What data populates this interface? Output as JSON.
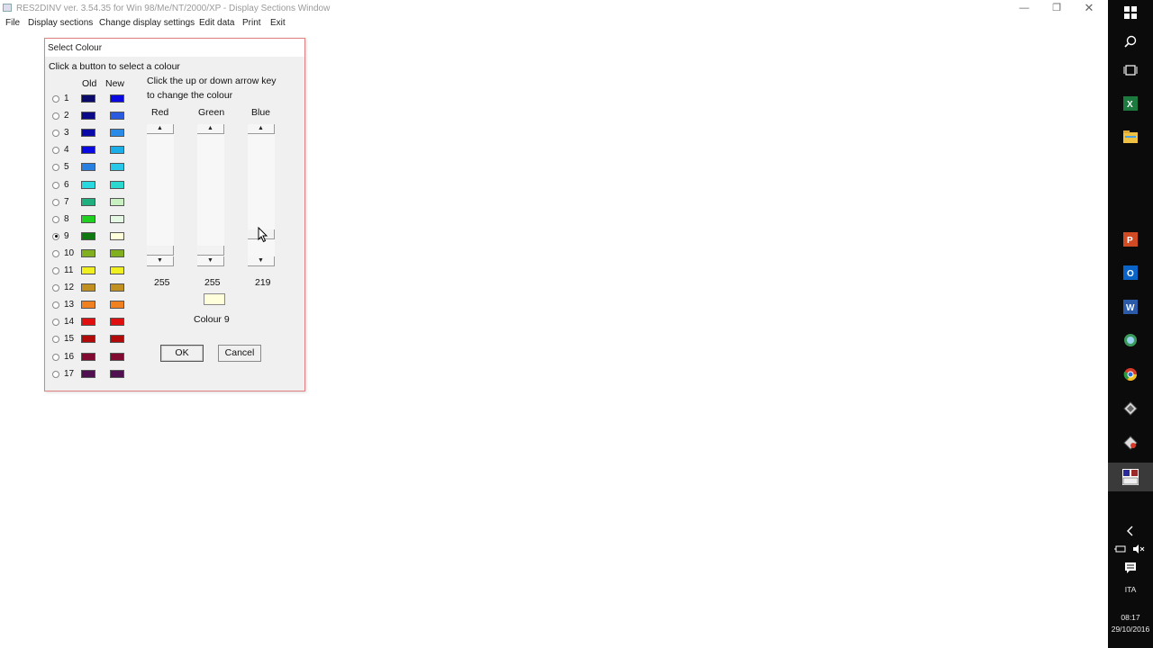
{
  "window": {
    "title": "RES2DINV ver. 3.54.35 for Win 98/Me/NT/2000/XP - Display Sections Window",
    "minimize_glyph": "—",
    "restore_glyph": "❐",
    "close_glyph": "✕"
  },
  "menu": {
    "items": [
      "File",
      "Display sections",
      "Change display settings",
      "Edit data",
      "Print",
      "Exit"
    ]
  },
  "dialog": {
    "title": "Select Colour",
    "instruction": "Click a button to select a colour",
    "arrow_instruction_line1": "Click the up or down arrow key",
    "arrow_instruction_line2": "to change the colour",
    "old_label": "Old",
    "new_label": "New",
    "selected_index": 9,
    "rows": [
      {
        "num": "1",
        "old": "#0a0a6a",
        "new": "#0a0ae0"
      },
      {
        "num": "2",
        "old": "#0a0a88",
        "new": "#2a5ae0"
      },
      {
        "num": "3",
        "old": "#0a0aa8",
        "new": "#2a8ae8"
      },
      {
        "num": "4",
        "old": "#0a0ae0",
        "new": "#1aaee8"
      },
      {
        "num": "5",
        "old": "#2a80e0",
        "new": "#2ac8e8"
      },
      {
        "num": "6",
        "old": "#2ad8e0",
        "new": "#2ad8d0"
      },
      {
        "num": "7",
        "old": "#20b080",
        "new": "#c8f0c0"
      },
      {
        "num": "8",
        "old": "#20d020",
        "new": "#e4f8e4"
      },
      {
        "num": "9",
        "old": "#107810",
        "new": "#ffffdb"
      },
      {
        "num": "10",
        "old": "#80b020",
        "new": "#80b020"
      },
      {
        "num": "11",
        "old": "#f0f020",
        "new": "#f0f020"
      },
      {
        "num": "12",
        "old": "#c09020",
        "new": "#c09020"
      },
      {
        "num": "13",
        "old": "#f08020",
        "new": "#f08020"
      },
      {
        "num": "14",
        "old": "#e01010",
        "new": "#e01010"
      },
      {
        "num": "15",
        "old": "#b00a0a",
        "new": "#b00a0a"
      },
      {
        "num": "16",
        "old": "#800a30",
        "new": "#800a30"
      },
      {
        "num": "17",
        "old": "#501050",
        "new": "#501050"
      }
    ],
    "red_label": "Red",
    "green_label": "Green",
    "blue_label": "Blue",
    "red_value": "255",
    "green_value": "255",
    "blue_value": "219",
    "preview_color": "#ffffdb",
    "colour_label": "Colour 9",
    "ok_label": "OK",
    "cancel_label": "Cancel",
    "up_glyph": "▲",
    "down_glyph": "▼"
  },
  "taskbar": {
    "icons": [
      "windows-start-icon",
      "search-icon",
      "task-view-icon",
      "excel-icon",
      "file-explorer-icon",
      "powerpoint-icon",
      "outlook-icon",
      "word-icon",
      "browser-icon",
      "chrome-icon",
      "app-icon-a",
      "app-icon-b",
      "res2dinv-icon",
      "show-hidden-icons-chevron",
      "network-icon",
      "volume-muted-icon",
      "action-center-icon"
    ],
    "language": "ITA",
    "time": "08:17",
    "date": "29/10/2016"
  }
}
